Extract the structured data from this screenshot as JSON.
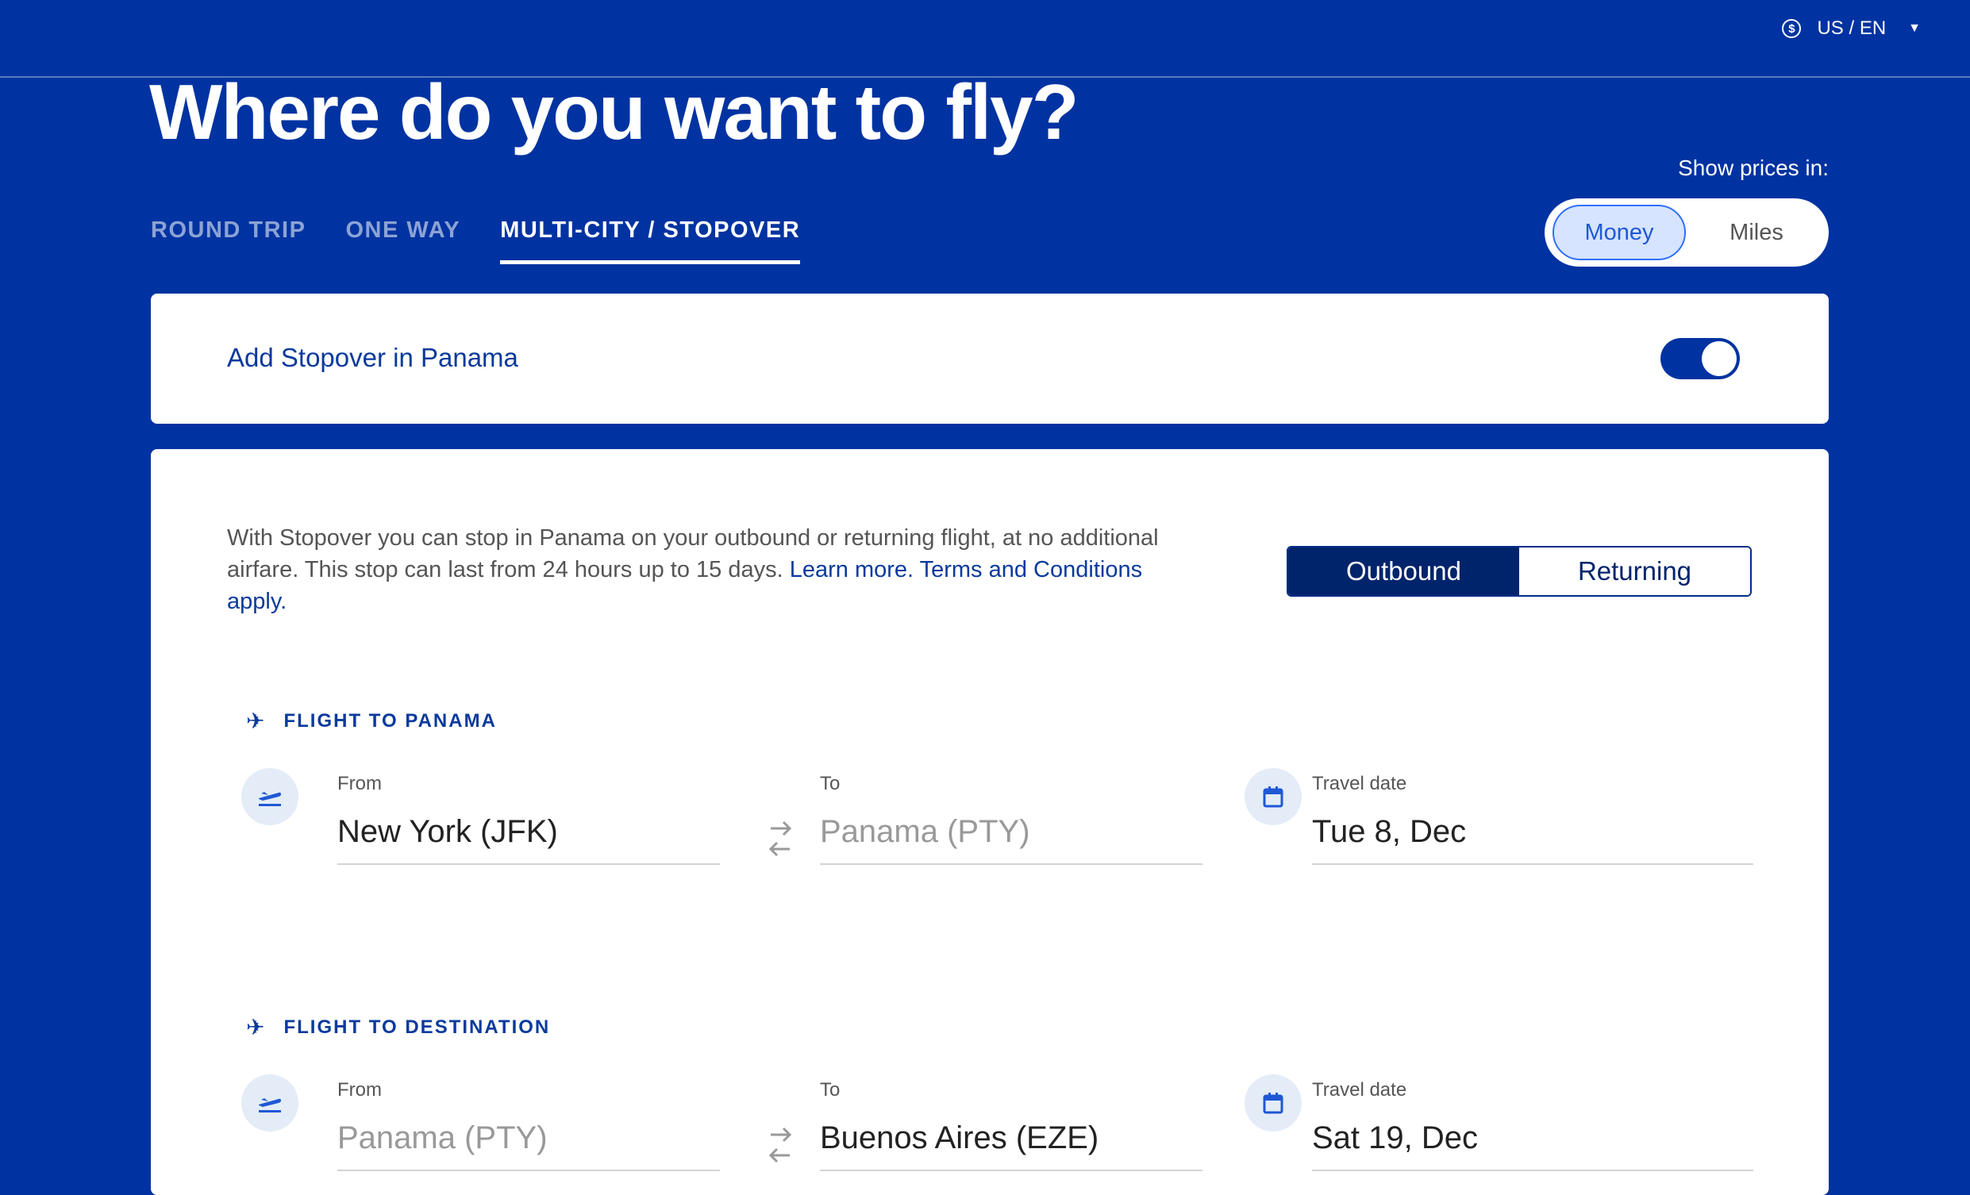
{
  "header": {
    "locale": "US / EN",
    "title": "Where do you want to fly?"
  },
  "prices": {
    "label": "Show prices in:",
    "money": "Money",
    "miles": "Miles",
    "selected": "Money"
  },
  "tabs": [
    "ROUND TRIP",
    "ONE WAY",
    "MULTI-CITY / STOPOVER"
  ],
  "active_tab": "MULTI-CITY / STOPOVER",
  "stopover": {
    "label": "Add Stopover in Panama",
    "enabled": true
  },
  "info": {
    "text": "With Stopover you can stop in Panama on your outbound or returning flight, at no additional airfare. This stop can last from 24 hours up to 15 days. ",
    "learn_more": "Learn more.",
    "terms": " Terms and Conditions apply."
  },
  "direction": {
    "outbound": "Outbound",
    "returning": "Returning",
    "selected": "Outbound"
  },
  "flights": [
    {
      "title": "FLIGHT TO PANAMA",
      "from_label": "From",
      "from": "New York (JFK)",
      "to_label": "To",
      "to": "Panama (PTY)",
      "date_label": "Travel date",
      "date": "Tue 8, Dec"
    },
    {
      "title": "FLIGHT TO DESTINATION",
      "from_label": "From",
      "from": "Panama (PTY)",
      "to_label": "To",
      "to": "Buenos Aires (EZE)",
      "date_label": "Travel date",
      "date": "Sat 19, Dec"
    }
  ],
  "colors": {
    "brand": "#0033a1",
    "accent": "#2f6fff",
    "dark": "#00246b"
  }
}
